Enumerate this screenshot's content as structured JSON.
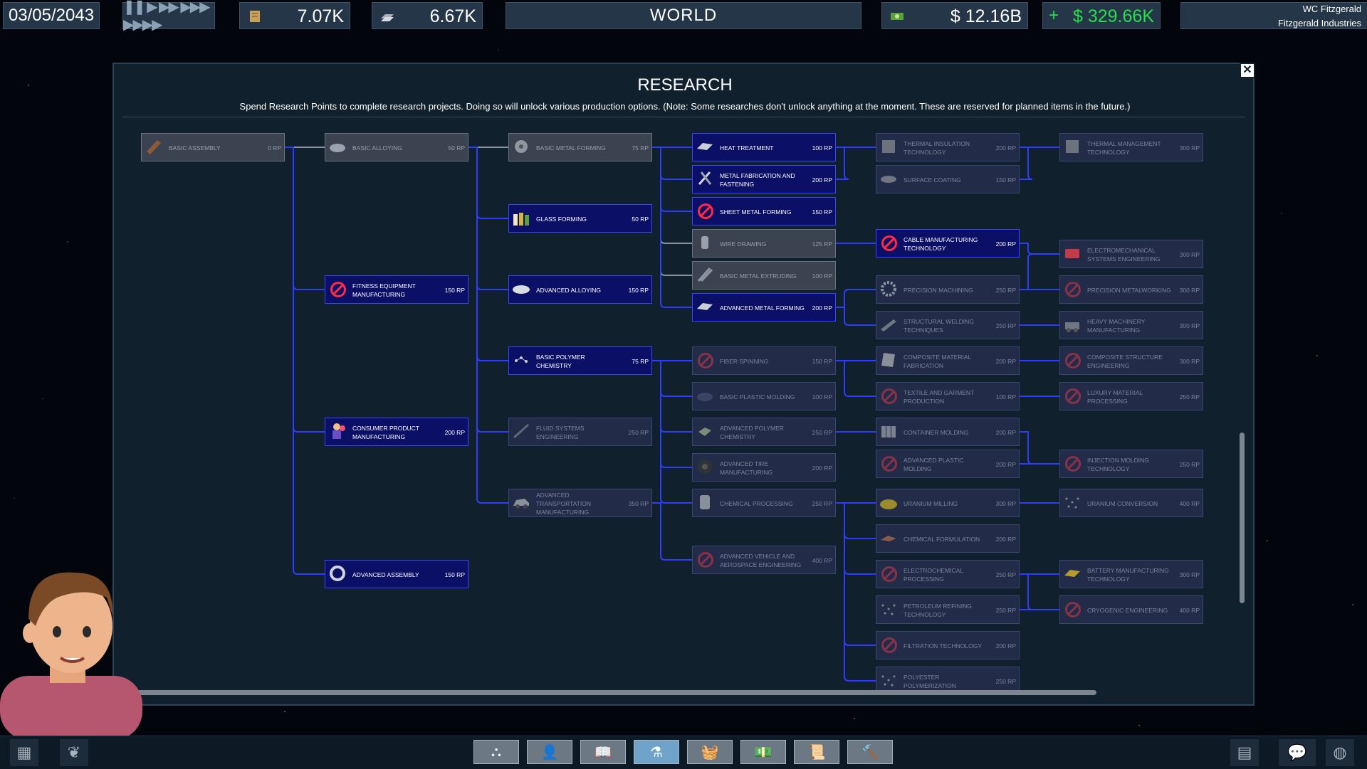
{
  "topbar": {
    "date": "03/05/2043",
    "speed_controls": "❚❚ ▶ ▶▶ ▶▶▶ ▶▶▶▶",
    "research_points": "7.07K",
    "resource_2": "6.67K",
    "view": "WORLD",
    "money": "$ 12.16B",
    "income_sign": "+",
    "income": "$ 329.66K",
    "player_name": "WC Fitzgerald",
    "company_name": "Fitzgerald Industries"
  },
  "panel": {
    "title": "RESEARCH",
    "description": "Spend Research Points to complete research projects. Doing so will unlock various production options. (Note: Some researches don't unlock anything at the moment. These are reserved for planned items in the future.)",
    "close_label": "✕"
  },
  "nodes": [
    {
      "name": "BASIC ASSEMBLY",
      "rp": "0 RP",
      "state": "done",
      "icon": "plank"
    },
    {
      "name": "BASIC ALLOYING",
      "rp": "50 RP",
      "state": "done",
      "icon": "ingot"
    },
    {
      "name": "BASIC METAL FORMING",
      "rp": "75 RP",
      "state": "done",
      "icon": "parts"
    },
    {
      "name": "HEAT TREATMENT",
      "rp": "100 RP",
      "state": "avail",
      "icon": "plate"
    },
    {
      "name": "THERMAL INSULATION TECHNOLOGY",
      "rp": "200 RP",
      "state": "locked",
      "icon": "panel"
    },
    {
      "name": "THERMAL MANAGEMENT TECHNOLOGY",
      "rp": "300 RP",
      "state": "locked",
      "icon": "panel"
    },
    {
      "name": "METAL FABRICATION AND FASTENING",
      "rp": "200 RP",
      "state": "avail",
      "icon": "tools"
    },
    {
      "name": "SURFACE COATING",
      "rp": "150 RP",
      "state": "locked",
      "icon": "coat"
    },
    {
      "name": "GLASS FORMING",
      "rp": "50 RP",
      "state": "avail",
      "icon": "bottles"
    },
    {
      "name": "SHEET METAL FORMING",
      "rp": "150 RP",
      "state": "avail",
      "icon": "ban"
    },
    {
      "name": "WIRE DRAWING",
      "rp": "125 RP",
      "state": "done",
      "icon": "wire"
    },
    {
      "name": "CABLE MANUFACTURING TECHNOLOGY",
      "rp": "200 RP",
      "state": "avail",
      "icon": "ban"
    },
    {
      "name": "ELECTROMECHANICAL SYSTEMS ENGINEERING",
      "rp": "300 RP",
      "state": "locked",
      "icon": "motor"
    },
    {
      "name": "BASIC METAL EXTRUDING",
      "rp": "100 RP",
      "state": "done",
      "icon": "rods"
    },
    {
      "name": "FITNESS EQUIPMENT MANUFACTURING",
      "rp": "150 RP",
      "state": "avail",
      "icon": "ban"
    },
    {
      "name": "ADVANCED ALLOYING",
      "rp": "150 RP",
      "state": "avail",
      "icon": "disc"
    },
    {
      "name": "PRECISION MACHINING",
      "rp": "250 RP",
      "state": "locked",
      "icon": "gear"
    },
    {
      "name": "PRECISION METALWORKING",
      "rp": "300 RP",
      "state": "locked",
      "icon": "ban"
    },
    {
      "name": "ADVANCED METAL FORMING",
      "rp": "200 RP",
      "state": "avail",
      "icon": "plate"
    },
    {
      "name": "STRUCTURAL WELDING TECHNIQUES",
      "rp": "250 RP",
      "state": "locked",
      "icon": "beam"
    },
    {
      "name": "HEAVY MACHINERY MANUFACTURING",
      "rp": "300 RP",
      "state": "locked",
      "icon": "machine"
    },
    {
      "name": "BASIC POLYMER CHEMISTRY",
      "rp": "75 RP",
      "state": "avail",
      "icon": "molecule"
    },
    {
      "name": "FIBER SPINNING",
      "rp": "150 RP",
      "state": "locked",
      "icon": "ban"
    },
    {
      "name": "COMPOSITE MATERIAL FABRICATION",
      "rp": "200 RP",
      "state": "locked",
      "icon": "sheet"
    },
    {
      "name": "COMPOSITE STRUCTURE ENGINEERING",
      "rp": "300 RP",
      "state": "locked",
      "icon": "ban"
    },
    {
      "name": "BASIC PLASTIC MOLDING",
      "rp": "100 RP",
      "state": "locked",
      "icon": "blob"
    },
    {
      "name": "TEXTILE AND GARMENT PRODUCTION",
      "rp": "100 RP",
      "state": "locked",
      "icon": "ban"
    },
    {
      "name": "LUXURY MATERIAL PROCESSING",
      "rp": "250 RP",
      "state": "locked",
      "icon": "ban"
    },
    {
      "name": "CONSUMER PRODUCT MANUFACTURING",
      "rp": "200 RP",
      "state": "avail",
      "icon": "person"
    },
    {
      "name": "FLUID SYSTEMS ENGINEERING",
      "rp": "250 RP",
      "state": "locked",
      "icon": "pipe"
    },
    {
      "name": "ADVANCED POLYMER CHEMISTRY",
      "rp": "250 RP",
      "state": "locked",
      "icon": "cube"
    },
    {
      "name": "CONTAINER MOLDING",
      "rp": "200 RP",
      "state": "locked",
      "icon": "cups"
    },
    {
      "name": "ADVANCED TIRE MANUFACTURING",
      "rp": "200 RP",
      "state": "locked",
      "icon": "tire"
    },
    {
      "name": "ADVANCED PLASTIC MOLDING",
      "rp": "200 RP",
      "state": "locked",
      "icon": "ban"
    },
    {
      "name": "INJECTION MOLDING TECHNOLOGY",
      "rp": "250 RP",
      "state": "locked",
      "icon": "ban"
    },
    {
      "name": "ADVANCED TRANSPORTATION MANUFACTURING",
      "rp": "350 RP",
      "state": "locked",
      "icon": "car"
    },
    {
      "name": "CHEMICAL PROCESSING",
      "rp": "250 RP",
      "state": "locked",
      "icon": "barrel"
    },
    {
      "name": "URANIUM MILLING",
      "rp": "300 RP",
      "state": "locked",
      "icon": "pile"
    },
    {
      "name": "URANIUM CONVERSION",
      "rp": "400 RP",
      "state": "locked",
      "icon": "dots"
    },
    {
      "name": "CHEMICAL FORMULATION",
      "rp": "200 RP",
      "state": "locked",
      "icon": "flask"
    },
    {
      "name": "ADVANCED VEHICLE AND AEROSPACE ENGINEERING",
      "rp": "400 RP",
      "state": "locked",
      "icon": "ban"
    },
    {
      "name": "ELECTROCHEMICAL PROCESSING",
      "rp": "250 RP",
      "state": "locked",
      "icon": "ban"
    },
    {
      "name": "BATTERY MANUFACTURING TECHNOLOGY",
      "rp": "300 RP",
      "state": "locked",
      "icon": "battery"
    },
    {
      "name": "ADVANCED ASSEMBLY",
      "rp": "150 RP",
      "state": "avail",
      "icon": "ring"
    },
    {
      "name": "PETROLEUM REFINING TECHNOLOGY",
      "rp": "250 RP",
      "state": "locked",
      "icon": "dots"
    },
    {
      "name": "CRYOGENIC ENGINEERING",
      "rp": "400 RP",
      "state": "locked",
      "icon": "ban"
    },
    {
      "name": "FILTRATION TECHNOLOGY",
      "rp": "200 RP",
      "state": "locked",
      "icon": "ban"
    },
    {
      "name": "POLYESTER POLYMERIZATION",
      "rp": "250 RP",
      "state": "locked",
      "icon": "dots"
    }
  ],
  "bottombar": {
    "left_icons": [
      "grid-icon",
      "plant-icon"
    ],
    "tabs": [
      "org-chart-icon",
      "add-person-icon",
      "book-icon",
      "flask-icon",
      "basket-icon",
      "money-icon",
      "contract-icon",
      "hammer-icon"
    ],
    "active_tab": "flask-icon",
    "right_icons": [
      "archive-icon",
      "chat-icon",
      "globe-icon"
    ]
  },
  "colors": {
    "available": "#0b0f66",
    "done": "#3b4350",
    "locked": "#222b48",
    "link": "#2d3cff",
    "income": "#25e04a",
    "ban": "#ff2a44"
  }
}
